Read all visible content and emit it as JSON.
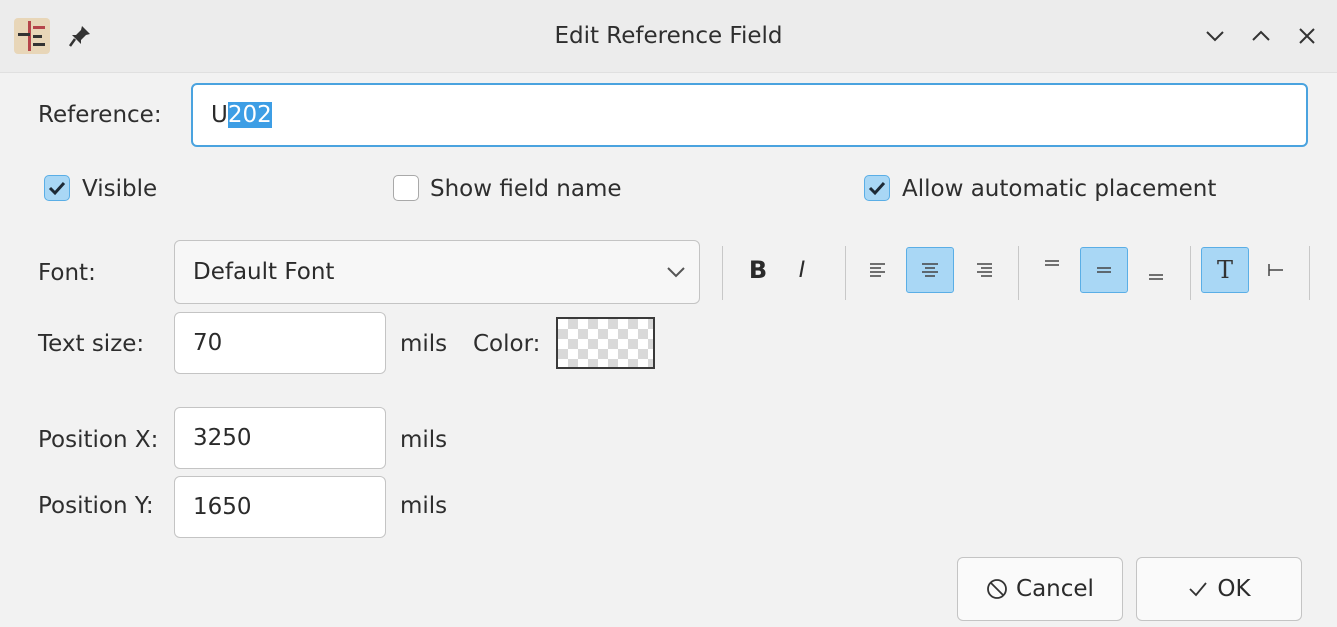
{
  "window": {
    "title": "Edit Reference Field"
  },
  "reference": {
    "label": "Reference:",
    "prefix": "U",
    "selected": "202"
  },
  "checkboxes": {
    "visible": {
      "label": "Visible",
      "checked": true
    },
    "show_field_name": {
      "label": "Show field name",
      "checked": false
    },
    "auto_place": {
      "label": "Allow automatic placement",
      "checked": true
    }
  },
  "font": {
    "label": "Font:",
    "value": "Default Font"
  },
  "toolbar": {
    "bold": "B",
    "italic": "I",
    "t_glyph": "T"
  },
  "text_size": {
    "label": "Text size:",
    "value": "70",
    "unit": "mils"
  },
  "color": {
    "label": "Color:"
  },
  "pos_x": {
    "label": "Position X:",
    "value": "3250",
    "unit": "mils"
  },
  "pos_y": {
    "label": "Position Y:",
    "value": "1650",
    "unit": "mils"
  },
  "buttons": {
    "cancel": "Cancel",
    "ok": "OK"
  },
  "colors": {
    "accent": "#4aa3df",
    "selection": "#3d9ee5",
    "active_fill": "#a9d7f5"
  }
}
